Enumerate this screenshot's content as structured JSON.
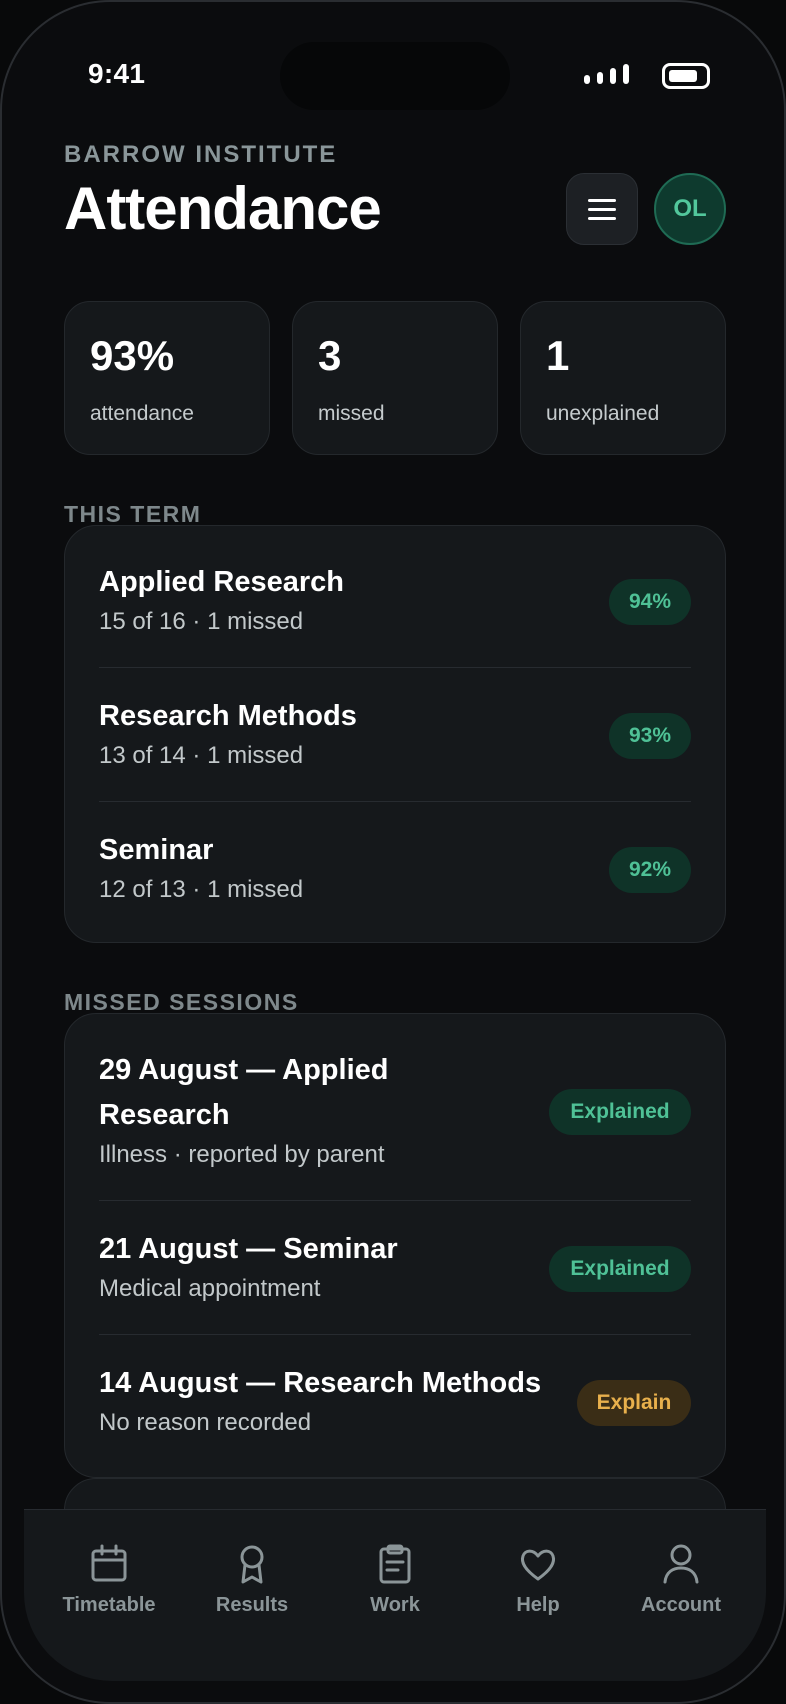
{
  "status_bar": {
    "time": "9:41"
  },
  "header": {
    "institution": "BARROW INSTITUTE",
    "title": "Attendance",
    "avatar_initials": "OL"
  },
  "stats": [
    {
      "value": "93%",
      "label": "attendance"
    },
    {
      "value": "3",
      "label": "missed"
    },
    {
      "value": "1",
      "label": "unexplained"
    }
  ],
  "this_term": {
    "label": "THIS TERM",
    "courses": [
      {
        "name": "Applied Research",
        "detail": "15 of 16 · 1 missed",
        "percent": "94%"
      },
      {
        "name": "Research Methods",
        "detail": "13 of 14 · 1 missed",
        "percent": "93%"
      },
      {
        "name": "Seminar",
        "detail": "12 of 13 · 1 missed",
        "percent": "92%"
      }
    ]
  },
  "missed_sessions": {
    "label": "MISSED SESSIONS",
    "items": [
      {
        "title": "29 August — Applied Research",
        "reason": "Illness · reported by parent",
        "status": "Explained"
      },
      {
        "title": "21 August — Seminar",
        "reason": "Medical appointment",
        "status": "Explained"
      },
      {
        "title": "14 August — Research Methods",
        "reason": "No reason recorded",
        "status": "Explain"
      }
    ]
  },
  "tab_bar": [
    {
      "label": "Timetable",
      "icon": "calendar-icon"
    },
    {
      "label": "Results",
      "icon": "award-icon"
    },
    {
      "label": "Work",
      "icon": "clipboard-icon"
    },
    {
      "label": "Help",
      "icon": "heart-icon"
    },
    {
      "label": "Account",
      "icon": "user-icon"
    }
  ],
  "colors": {
    "accent_green": "#4fc196",
    "accent_amber": "#e8b04c",
    "background": "#0b0c0e",
    "card": "#15181b"
  }
}
